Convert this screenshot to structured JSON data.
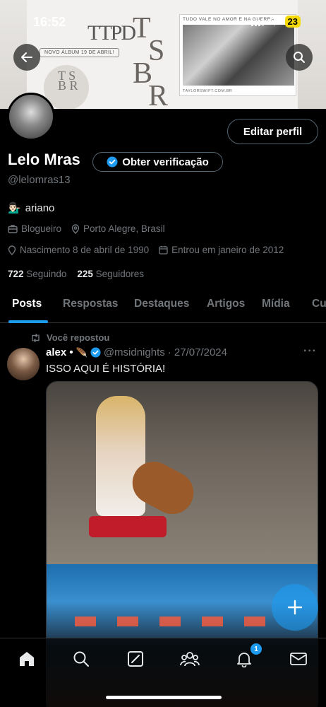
{
  "status": {
    "time": "16:52",
    "battery": "23"
  },
  "banner": {
    "logo_text": "TTPD",
    "album_pill": "NOVO ÁLBUM 19 DE ABRIL!",
    "tsbr": [
      "T",
      "S",
      "B",
      "R"
    ],
    "photo_caption": "TUDO VALE NO AMOR E NA GUERRA",
    "photo_url": "TAYLORSWIFT.COM.BR"
  },
  "profile": {
    "name": "Lelo Mras",
    "verify_label": "Obter verificação",
    "handle": "@lelomras13",
    "edit_label": "Editar perfil",
    "bio": "ariano",
    "category": "Blogueiro",
    "location": "Porto Alegre, Brasil",
    "birth": "Nascimento 8 de abril de 1990",
    "joined": "Entrou em janeiro de 2012",
    "following_count": "722",
    "following_label": "Seguindo",
    "followers_count": "225",
    "followers_label": "Seguidores"
  },
  "tabs": [
    "Posts",
    "Respostas",
    "Destaques",
    "Artigos",
    "Mídia",
    "Cu"
  ],
  "post": {
    "repost_label": "Você repostou",
    "author_name": "alex •",
    "author_handle": "@msidnights",
    "date": "· 27/07/2024",
    "text": "ISSO AQUI É HISTÓRIA!",
    "more": "···"
  },
  "nav": {
    "notif_badge": "1"
  },
  "colors": {
    "accent": "#1d9bf0",
    "muted": "#71767b",
    "border": "#2f3336"
  }
}
